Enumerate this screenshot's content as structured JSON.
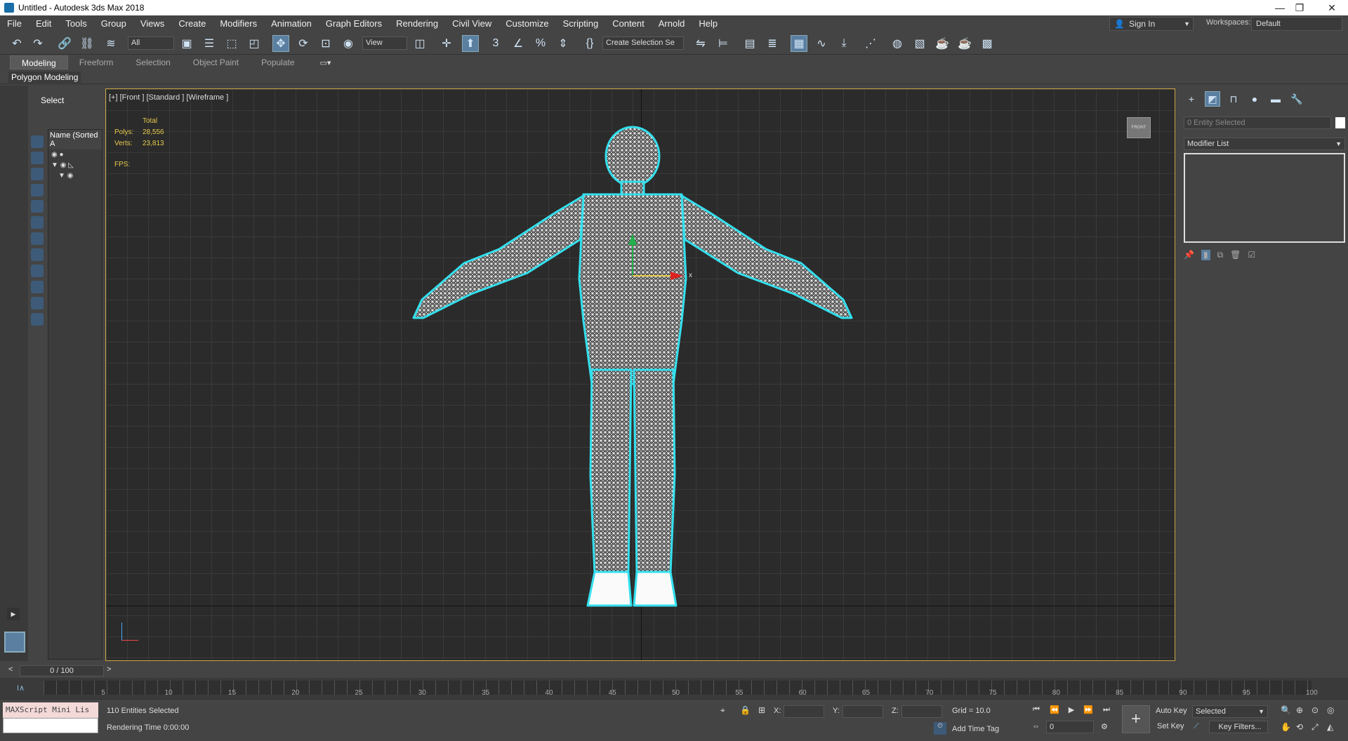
{
  "window": {
    "title": "Untitled - Autodesk 3ds Max 2018",
    "minimize": "—",
    "restore": "❐",
    "close": "✕"
  },
  "menu": [
    "File",
    "Edit",
    "Tools",
    "Group",
    "Views",
    "Create",
    "Modifiers",
    "Animation",
    "Graph Editors",
    "Rendering",
    "Civil View",
    "Customize",
    "Scripting",
    "Content",
    "Arnold",
    "Help"
  ],
  "account": {
    "signin": "Sign In",
    "workspaces_label": "Workspaces:",
    "workspace": "Default"
  },
  "toolbar": {
    "filter": "All",
    "refcoord": "View",
    "selection_set": "Create Selection Se"
  },
  "ribbon": {
    "tabs": [
      "Modeling",
      "Freeform",
      "Selection",
      "Object Paint",
      "Populate"
    ],
    "sub": "Polygon Modeling"
  },
  "scene_explorer": {
    "select_label": "Select",
    "column": "Name (Sorted A"
  },
  "viewport": {
    "label": "[+] [Front ] [Standard ] [Wireframe ]",
    "stats": {
      "total_label": "Total",
      "polys_label": "Polys:",
      "polys": "28,556",
      "verts_label": "Verts:",
      "verts": "23,813",
      "fps_label": "FPS:"
    },
    "viewcube": "FRONT",
    "axis_x": "x"
  },
  "command_panel": {
    "entity": "0 Entity Selected",
    "modifier_list": "Modifier List"
  },
  "timeline": {
    "frame": "0 / 100",
    "ticks": [
      "5",
      "10",
      "15",
      "20",
      "25",
      "30",
      "35",
      "40",
      "45",
      "50",
      "55",
      "60",
      "65",
      "70",
      "75",
      "80",
      "85",
      "90",
      "95",
      "100"
    ]
  },
  "status": {
    "maxscript": "MAXScript Mini Lis",
    "selected": "110 Entities Selected",
    "render_time": "Rendering Time  0:00:00",
    "x_label": "X:",
    "y_label": "Y:",
    "z_label": "Z:",
    "grid": "Grid = 10.0",
    "add_time_tag": "Add Time Tag",
    "auto_key": "Auto Key",
    "set_key": "Set Key",
    "key_mode": "Selected",
    "key_filters": "Key Filters...",
    "frame_field": "0"
  },
  "colors": {
    "viewport_border": "#c9a443",
    "wire_outline": "#33e0ee",
    "stats": "#e6c94a"
  }
}
